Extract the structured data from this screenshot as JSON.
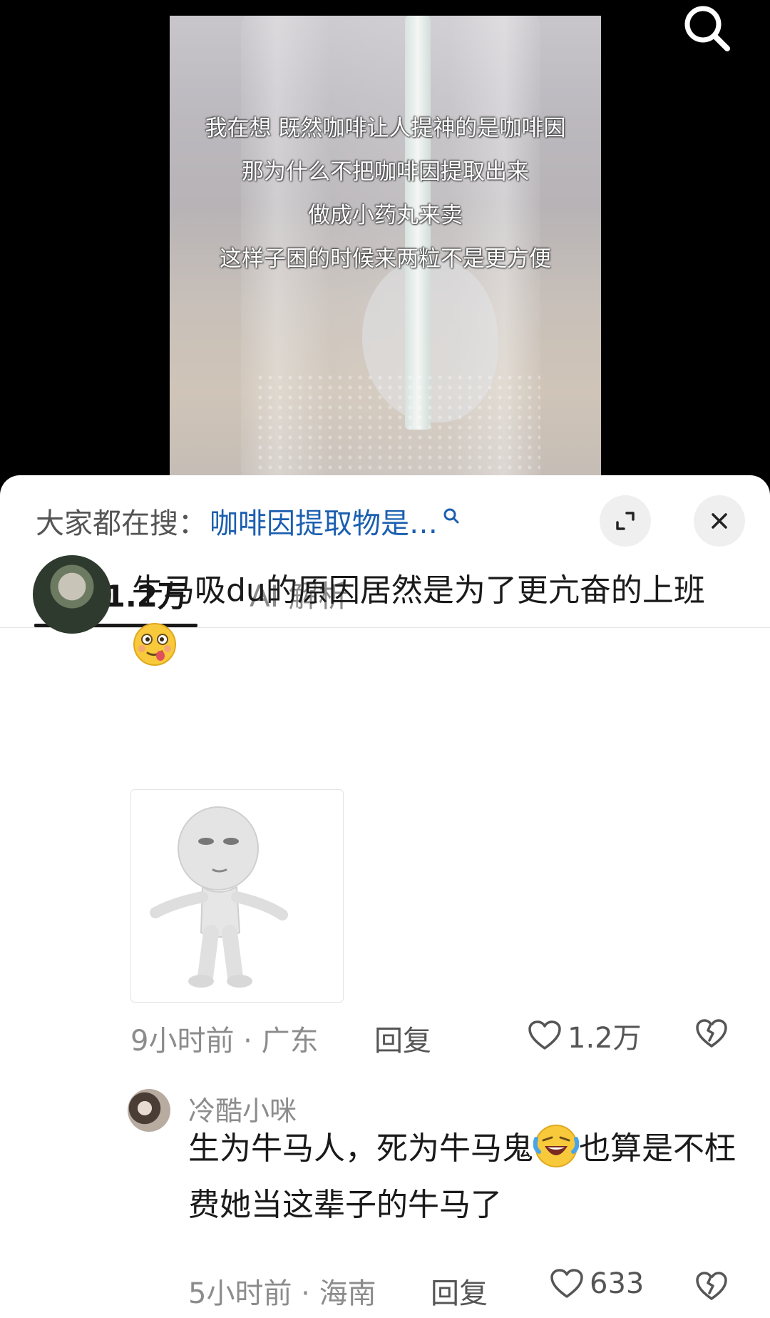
{
  "video": {
    "caption_lines": [
      "我在想 既然咖啡让人提神的是咖啡因",
      "那为什么不把咖啡因提取出来",
      "做成小药丸来卖",
      "这样子困的时候来两粒不是更方便"
    ],
    "search_icon": "search-icon"
  },
  "sheet": {
    "trending_label": "大家都在搜：",
    "trending_query": "咖啡因提取物是…",
    "expand_icon": "expand-icon",
    "close_icon": "close-icon",
    "tabs": [
      {
        "label": "评论 1.2万",
        "active": true
      },
      {
        "label": "AI 解析",
        "active": false
      }
    ]
  },
  "comments": [
    {
      "text_before_emoji": "牛马吸du的原因居然是为了更亢奋的上班",
      "emoji": "woozy-face-emoji",
      "text_after_emoji": "",
      "has_sticker": true,
      "time_location": "9小时前 · 广东",
      "reply_label": "回复",
      "likes": "1.2万"
    },
    {
      "username": "冷酷小咪",
      "text_before_emoji": "生为牛马人，死为牛马鬼",
      "emoji": "rolling-laughing-emoji",
      "text_after_emoji": "也算是不枉费她当这辈子的牛马了",
      "time_location": "5小时前 · 海南",
      "reply_label": "回复",
      "likes": "633"
    }
  ],
  "colors": {
    "accent_link": "#1b5fb0",
    "sheet_bg": "#ffffff",
    "meta_gray": "#8c8c8c"
  }
}
